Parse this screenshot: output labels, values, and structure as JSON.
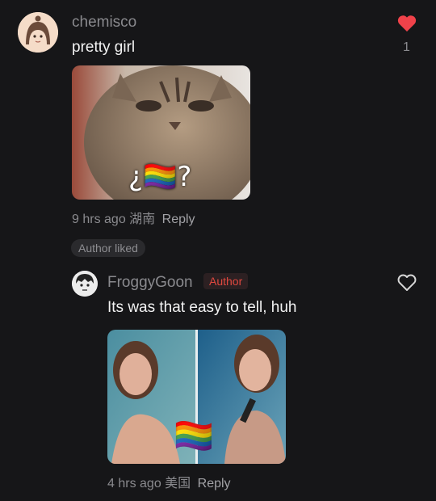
{
  "comments": [
    {
      "username": "chemisco",
      "text": "pretty girl",
      "like_count": "1",
      "liked": true,
      "media_overlay": "¿🏳️‍🌈?",
      "time": "9 hrs ago",
      "location": "湖南",
      "reply_label": "Reply"
    },
    {
      "author_liked_label": "Author liked",
      "username": "FroggyGoon",
      "author_badge": "Author",
      "text": "Its was that easy to tell, huh",
      "liked": false,
      "media_overlay": "🏳️‍🌈",
      "time": "4 hrs ago",
      "location": "美国",
      "reply_label": "Reply"
    }
  ],
  "colors": {
    "background": "#161618",
    "heart_liked": "#f0424a",
    "author_badge_text": "#e0483f"
  },
  "icons": {
    "liked_heart": "heart-filled-icon",
    "unliked_heart": "heart-outline-icon"
  }
}
